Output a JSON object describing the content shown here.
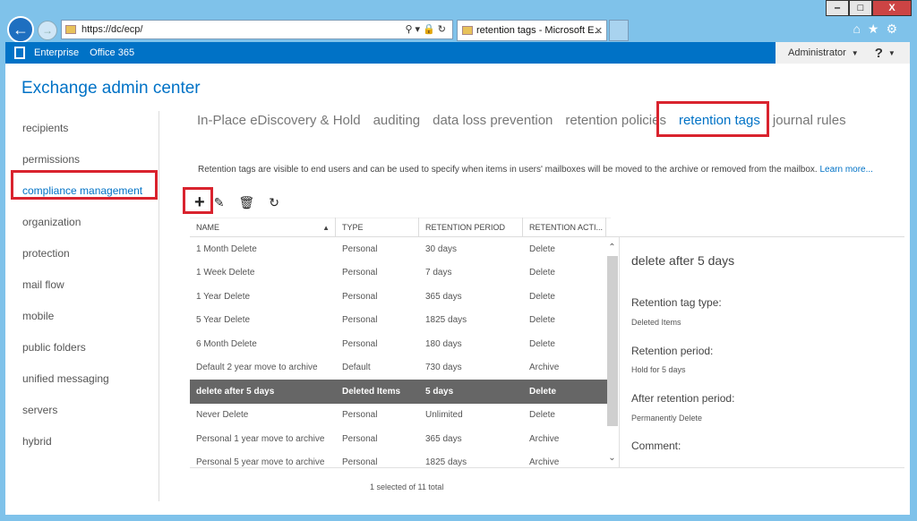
{
  "browser": {
    "url": "https://dc/ecp/",
    "tab_title": "retention tags - Microsoft E...",
    "window_controls": [
      "‒",
      "□",
      "X"
    ]
  },
  "o365bar": {
    "links": [
      "Enterprise",
      "Office 365"
    ],
    "user": "Administrator",
    "help": "?"
  },
  "app": {
    "title": "Exchange admin center"
  },
  "sidebar": {
    "items": [
      "recipients",
      "permissions",
      "compliance management",
      "organization",
      "protection",
      "mail flow",
      "mobile",
      "public folders",
      "unified messaging",
      "servers",
      "hybrid"
    ]
  },
  "subnav": {
    "items": [
      "In-Place eDiscovery & Hold",
      "auditing",
      "data loss prevention",
      "retention policies",
      "retention tags",
      "journal rules"
    ],
    "active": "retention tags"
  },
  "description": {
    "text": "Retention tags are visible to end users and can be used to specify when items in users' mailboxes will be moved to the archive or removed from the mailbox.",
    "link": "Learn more..."
  },
  "grid": {
    "columns": [
      "NAME",
      "TYPE",
      "RETENTION PERIOD",
      "RETENTION ACTI..."
    ],
    "rows": [
      [
        "1 Month Delete",
        "Personal",
        "30 days",
        "Delete"
      ],
      [
        "1 Week Delete",
        "Personal",
        "7 days",
        "Delete"
      ],
      [
        "1 Year Delete",
        "Personal",
        "365 days",
        "Delete"
      ],
      [
        "5 Year Delete",
        "Personal",
        "1825 days",
        "Delete"
      ],
      [
        "6 Month Delete",
        "Personal",
        "180 days",
        "Delete"
      ],
      [
        "Default 2 year move to archive",
        "Default",
        "730 days",
        "Archive"
      ],
      [
        "delete after 5 days",
        "Deleted Items",
        "5 days",
        "Delete"
      ],
      [
        "Never Delete",
        "Personal",
        "Unlimited",
        "Delete"
      ],
      [
        "Personal 1 year move to archive",
        "Personal",
        "365 days",
        "Archive"
      ],
      [
        "Personal 5 year move to archive",
        "Personal",
        "1825 days",
        "Archive"
      ]
    ],
    "selected_row": 6,
    "footer": "1 selected of 11 total"
  },
  "details": {
    "title": "delete after 5 days",
    "type_label": "Retention tag type:",
    "type_value": "Deleted Items",
    "period_label": "Retention period:",
    "period_value": "Hold for 5 days",
    "after_label": "After retention period:",
    "after_value": "Permanently Delete",
    "comment_label": "Comment:"
  }
}
